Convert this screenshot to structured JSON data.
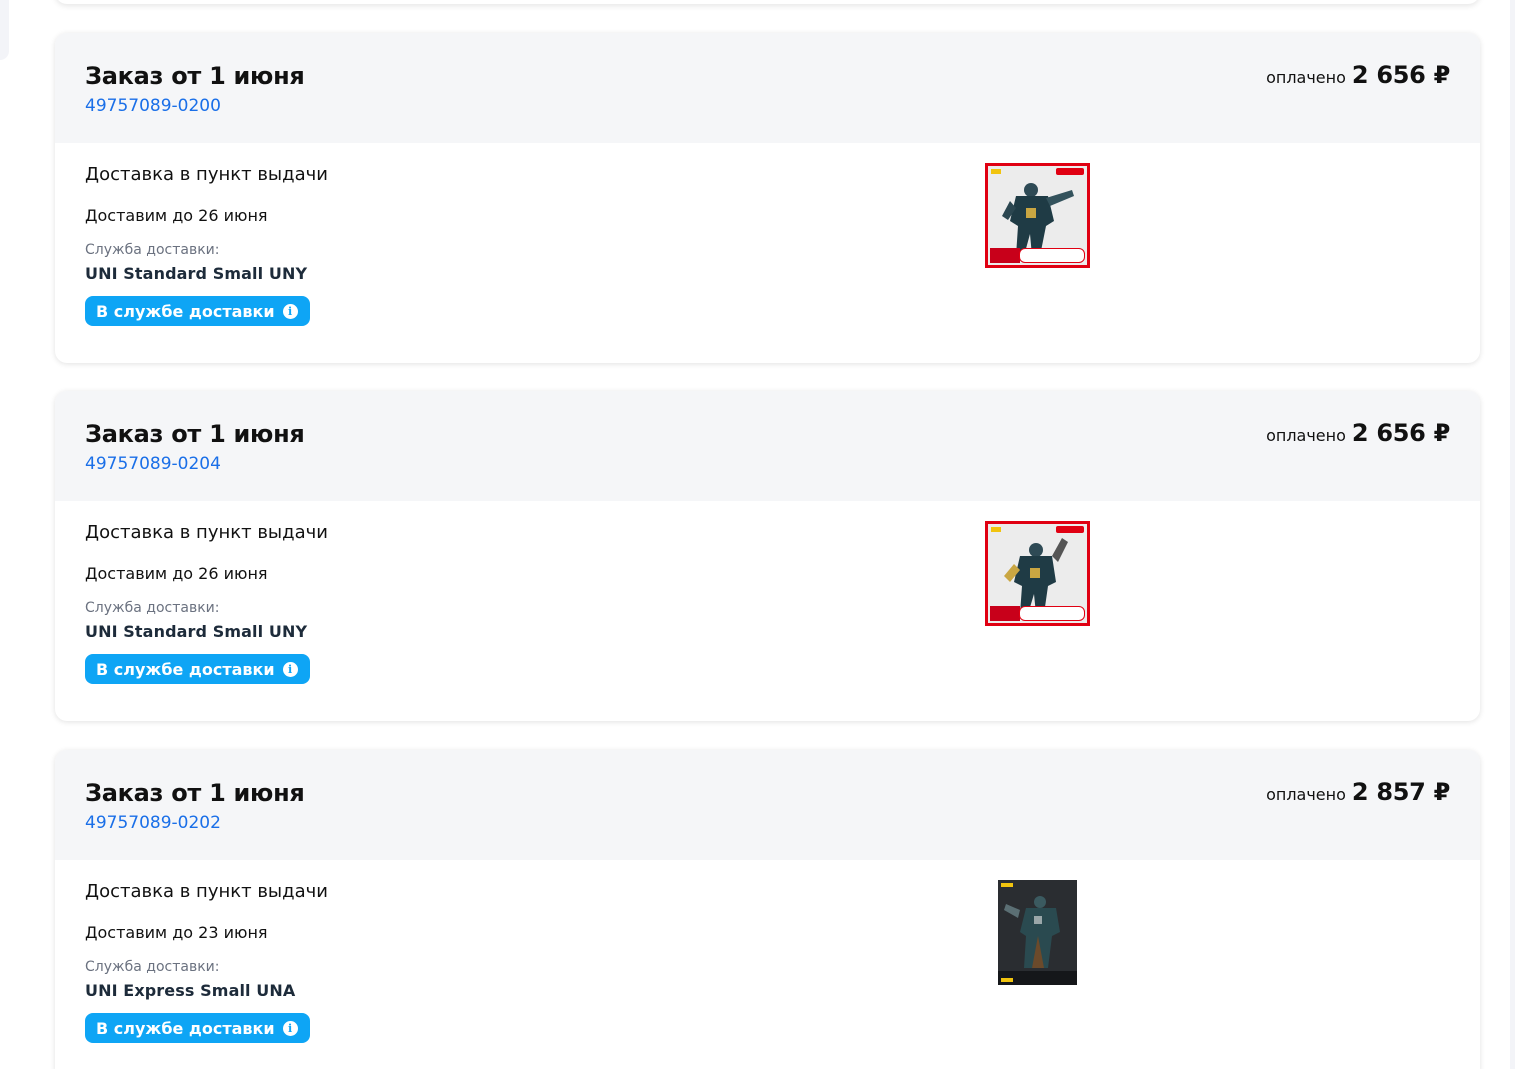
{
  "orders": [
    {
      "title": "Заказ от 1 июня",
      "number": "49757089-0200",
      "paid_label": "оплачено",
      "paid_amount": "2 656 ₽",
      "delivery_type": "Доставка в пункт выдачи",
      "delivery_date": "Доставим до 26 июня",
      "service_label": "Служба доставки:",
      "service_name": "UNI Standard Small UNY",
      "status": "В службе доставки",
      "product_image": "action-figure-red-frame"
    },
    {
      "title": "Заказ от 1 июня",
      "number": "49757089-0204",
      "paid_label": "оплачено",
      "paid_amount": "2 656 ₽",
      "delivery_type": "Доставка в пункт выдачи",
      "delivery_date": "Доставим до 26 июня",
      "service_label": "Служба доставки:",
      "service_name": "UNI Standard Small UNY",
      "status": "В службе доставки",
      "product_image": "action-figure-red-frame"
    },
    {
      "title": "Заказ от 1 июня",
      "number": "49757089-0202",
      "paid_label": "оплачено",
      "paid_amount": "2 857 ₽",
      "delivery_type": "Доставка в пункт выдачи",
      "delivery_date": "Доставим до 23 июня",
      "service_label": "Служба доставки:",
      "service_name": "UNI Express Small UNA",
      "status": "В службе доставки",
      "product_image": "action-figure-dark"
    }
  ],
  "icons": {
    "status_info": "info-icon"
  },
  "colors": {
    "link": "#1a6fe8",
    "status_badge": "#0ea5f5",
    "header_bg": "#f5f6f8",
    "page_bg": "#f3f4f8"
  }
}
